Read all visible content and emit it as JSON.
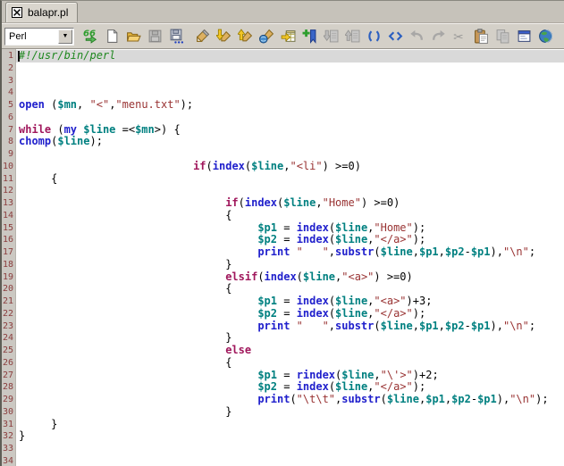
{
  "window": {
    "tab": {
      "label": "balapr.pl",
      "icon": "boxed-x"
    }
  },
  "toolbar": {
    "language_selector": {
      "value": "Perl",
      "icon": "dropdown-arrow"
    },
    "buttons": [
      {
        "icon": "syntax-check",
        "enabled": true
      },
      {
        "icon": "new-file",
        "enabled": true
      },
      {
        "icon": "open-file",
        "enabled": true
      },
      {
        "icon": "save",
        "enabled": false
      },
      {
        "icon": "save-as",
        "enabled": true
      },
      {
        "icon": "edit-pen",
        "enabled": true
      },
      {
        "icon": "download-pen",
        "enabled": true
      },
      {
        "icon": "upload-pen",
        "enabled": true
      },
      {
        "icon": "web-pen",
        "enabled": true
      },
      {
        "icon": "insert-table",
        "enabled": true
      },
      {
        "icon": "add-bookmark",
        "enabled": true
      },
      {
        "icon": "prev-bookmark",
        "enabled": false
      },
      {
        "icon": "next-bookmark",
        "enabled": false
      },
      {
        "icon": "match-parentheses",
        "enabled": true
      },
      {
        "icon": "match-tags",
        "enabled": true
      },
      {
        "icon": "undo",
        "enabled": false
      },
      {
        "icon": "redo",
        "enabled": false
      },
      {
        "icon": "cut",
        "enabled": false
      },
      {
        "icon": "paste",
        "enabled": true
      },
      {
        "icon": "copy",
        "enabled": false
      },
      {
        "icon": "window-form",
        "enabled": true
      },
      {
        "icon": "globe",
        "enabled": true
      }
    ]
  },
  "editor": {
    "total_lines": 34,
    "current_line": 1,
    "colors": {
      "keyword": "#2020CC",
      "control": "#A0175C",
      "variable": "#008080",
      "string": "#993333",
      "comment": "#1E871E",
      "punctuation": "#000000",
      "line_number": "#8B3E3E",
      "current_line_bg": "#D9D9D9",
      "background": "#FFFFFF"
    },
    "lines": [
      {
        "n": 1,
        "indent": 0,
        "tokens": [
          [
            "com",
            "#!/usr/bin/perl"
          ]
        ]
      },
      {
        "n": 2,
        "indent": 0,
        "tokens": []
      },
      {
        "n": 3,
        "indent": 0,
        "tokens": []
      },
      {
        "n": 4,
        "indent": 0,
        "tokens": []
      },
      {
        "n": 5,
        "indent": 0,
        "tokens": [
          [
            "kw1",
            "open"
          ],
          [
            "pun",
            " ("
          ],
          [
            "var",
            "$mn"
          ],
          [
            "pun",
            ", "
          ],
          [
            "str",
            "\"<\""
          ],
          [
            "pun",
            ","
          ],
          [
            "str",
            "\"menu.txt\""
          ],
          [
            "pun",
            ");"
          ]
        ]
      },
      {
        "n": 6,
        "indent": 0,
        "tokens": []
      },
      {
        "n": 7,
        "indent": 0,
        "tokens": [
          [
            "kw2",
            "while"
          ],
          [
            "pun",
            " ("
          ],
          [
            "kw1",
            "my"
          ],
          [
            "pun",
            " "
          ],
          [
            "var",
            "$line"
          ],
          [
            "pun",
            " =<"
          ],
          [
            "var",
            "$mn"
          ],
          [
            "pun",
            ">) {"
          ]
        ]
      },
      {
        "n": 8,
        "indent": 0,
        "tokens": [
          [
            "kw1",
            "chomp"
          ],
          [
            "pun",
            "("
          ],
          [
            "var",
            "$line"
          ],
          [
            "pun",
            ");"
          ]
        ]
      },
      {
        "n": 9,
        "indent": 0,
        "tokens": []
      },
      {
        "n": 10,
        "indent": 27,
        "tokens": [
          [
            "kw2",
            "if"
          ],
          [
            "pun",
            "("
          ],
          [
            "kw1",
            "index"
          ],
          [
            "pun",
            "("
          ],
          [
            "var",
            "$line"
          ],
          [
            "pun",
            ","
          ],
          [
            "str",
            "\"<li\""
          ],
          [
            "pun",
            ") >=0)"
          ]
        ]
      },
      {
        "n": 11,
        "indent": 5,
        "tokens": [
          [
            "pun",
            "{"
          ]
        ]
      },
      {
        "n": 12,
        "indent": 0,
        "tokens": []
      },
      {
        "n": 13,
        "indent": 32,
        "tokens": [
          [
            "kw2",
            "if"
          ],
          [
            "pun",
            "("
          ],
          [
            "kw1",
            "index"
          ],
          [
            "pun",
            "("
          ],
          [
            "var",
            "$line"
          ],
          [
            "pun",
            ","
          ],
          [
            "str",
            "\"Home\""
          ],
          [
            "pun",
            ") >=0)"
          ]
        ]
      },
      {
        "n": 14,
        "indent": 32,
        "tokens": [
          [
            "pun",
            "{"
          ]
        ]
      },
      {
        "n": 15,
        "indent": 37,
        "tokens": [
          [
            "var",
            "$p1"
          ],
          [
            "pun",
            " = "
          ],
          [
            "kw1",
            "index"
          ],
          [
            "pun",
            "("
          ],
          [
            "var",
            "$line"
          ],
          [
            "pun",
            ","
          ],
          [
            "str",
            "\"Home\""
          ],
          [
            "pun",
            ");"
          ]
        ]
      },
      {
        "n": 16,
        "indent": 37,
        "tokens": [
          [
            "var",
            "$p2"
          ],
          [
            "pun",
            " = "
          ],
          [
            "kw1",
            "index"
          ],
          [
            "pun",
            "("
          ],
          [
            "var",
            "$line"
          ],
          [
            "pun",
            ","
          ],
          [
            "str",
            "\"</a>\""
          ],
          [
            "pun",
            ");"
          ]
        ]
      },
      {
        "n": 17,
        "indent": 37,
        "tokens": [
          [
            "kw1",
            "print"
          ],
          [
            "pun",
            " "
          ],
          [
            "str",
            "\"   \""
          ],
          [
            "pun",
            ","
          ],
          [
            "kw1",
            "substr"
          ],
          [
            "pun",
            "("
          ],
          [
            "var",
            "$line"
          ],
          [
            "pun",
            ","
          ],
          [
            "var",
            "$p1"
          ],
          [
            "pun",
            ","
          ],
          [
            "var",
            "$p2"
          ],
          [
            "pun",
            "-"
          ],
          [
            "var",
            "$p1"
          ],
          [
            "pun",
            "),"
          ],
          [
            "str",
            "\"\\n\""
          ],
          [
            "pun",
            ";"
          ]
        ]
      },
      {
        "n": 18,
        "indent": 32,
        "tokens": [
          [
            "pun",
            "}"
          ]
        ]
      },
      {
        "n": 19,
        "indent": 32,
        "tokens": [
          [
            "kw2",
            "elsif"
          ],
          [
            "pun",
            "("
          ],
          [
            "kw1",
            "index"
          ],
          [
            "pun",
            "("
          ],
          [
            "var",
            "$line"
          ],
          [
            "pun",
            ","
          ],
          [
            "str",
            "\"<a>\""
          ],
          [
            "pun",
            ") >=0)"
          ]
        ]
      },
      {
        "n": 20,
        "indent": 32,
        "tokens": [
          [
            "pun",
            "{"
          ]
        ]
      },
      {
        "n": 21,
        "indent": 37,
        "tokens": [
          [
            "var",
            "$p1"
          ],
          [
            "pun",
            " = "
          ],
          [
            "kw1",
            "index"
          ],
          [
            "pun",
            "("
          ],
          [
            "var",
            "$line"
          ],
          [
            "pun",
            ","
          ],
          [
            "str",
            "\"<a>\""
          ],
          [
            "pun",
            ")+3;"
          ]
        ]
      },
      {
        "n": 22,
        "indent": 37,
        "tokens": [
          [
            "var",
            "$p2"
          ],
          [
            "pun",
            " = "
          ],
          [
            "kw1",
            "index"
          ],
          [
            "pun",
            "("
          ],
          [
            "var",
            "$line"
          ],
          [
            "pun",
            ","
          ],
          [
            "str",
            "\"</a>\""
          ],
          [
            "pun",
            ");"
          ]
        ]
      },
      {
        "n": 23,
        "indent": 37,
        "tokens": [
          [
            "kw1",
            "print"
          ],
          [
            "pun",
            " "
          ],
          [
            "str",
            "\"   \""
          ],
          [
            "pun",
            ","
          ],
          [
            "kw1",
            "substr"
          ],
          [
            "pun",
            "("
          ],
          [
            "var",
            "$line"
          ],
          [
            "pun",
            ","
          ],
          [
            "var",
            "$p1"
          ],
          [
            "pun",
            ","
          ],
          [
            "var",
            "$p2"
          ],
          [
            "pun",
            "-"
          ],
          [
            "var",
            "$p1"
          ],
          [
            "pun",
            "),"
          ],
          [
            "str",
            "\"\\n\""
          ],
          [
            "pun",
            ";"
          ]
        ]
      },
      {
        "n": 24,
        "indent": 32,
        "tokens": [
          [
            "pun",
            "}"
          ]
        ]
      },
      {
        "n": 25,
        "indent": 32,
        "tokens": [
          [
            "kw2",
            "else"
          ]
        ]
      },
      {
        "n": 26,
        "indent": 32,
        "tokens": [
          [
            "pun",
            "{"
          ]
        ]
      },
      {
        "n": 27,
        "indent": 37,
        "tokens": [
          [
            "var",
            "$p1"
          ],
          [
            "pun",
            " = "
          ],
          [
            "kw1",
            "rindex"
          ],
          [
            "pun",
            "("
          ],
          [
            "var",
            "$line"
          ],
          [
            "pun",
            ","
          ],
          [
            "str",
            "\"\\'>\""
          ],
          [
            "pun",
            ")+2;"
          ]
        ]
      },
      {
        "n": 28,
        "indent": 37,
        "tokens": [
          [
            "var",
            "$p2"
          ],
          [
            "pun",
            " = "
          ],
          [
            "kw1",
            "index"
          ],
          [
            "pun",
            "("
          ],
          [
            "var",
            "$line"
          ],
          [
            "pun",
            ","
          ],
          [
            "str",
            "\"</a>\""
          ],
          [
            "pun",
            ");"
          ]
        ]
      },
      {
        "n": 29,
        "indent": 37,
        "tokens": [
          [
            "kw1",
            "print"
          ],
          [
            "pun",
            "("
          ],
          [
            "str",
            "\"\\t\\t\""
          ],
          [
            "pun",
            ","
          ],
          [
            "kw1",
            "substr"
          ],
          [
            "pun",
            "("
          ],
          [
            "var",
            "$line"
          ],
          [
            "pun",
            ","
          ],
          [
            "var",
            "$p1"
          ],
          [
            "pun",
            ","
          ],
          [
            "var",
            "$p2"
          ],
          [
            "pun",
            "-"
          ],
          [
            "var",
            "$p1"
          ],
          [
            "pun",
            "),"
          ],
          [
            "str",
            "\"\\n\""
          ],
          [
            "pun",
            ");"
          ]
        ]
      },
      {
        "n": 30,
        "indent": 32,
        "tokens": [
          [
            "pun",
            "}"
          ]
        ]
      },
      {
        "n": 31,
        "indent": 5,
        "tokens": [
          [
            "pun",
            "}"
          ]
        ]
      },
      {
        "n": 32,
        "indent": 0,
        "tokens": [
          [
            "pun",
            "}"
          ]
        ]
      },
      {
        "n": 33,
        "indent": 0,
        "tokens": []
      },
      {
        "n": 34,
        "indent": 0,
        "tokens": []
      }
    ]
  }
}
